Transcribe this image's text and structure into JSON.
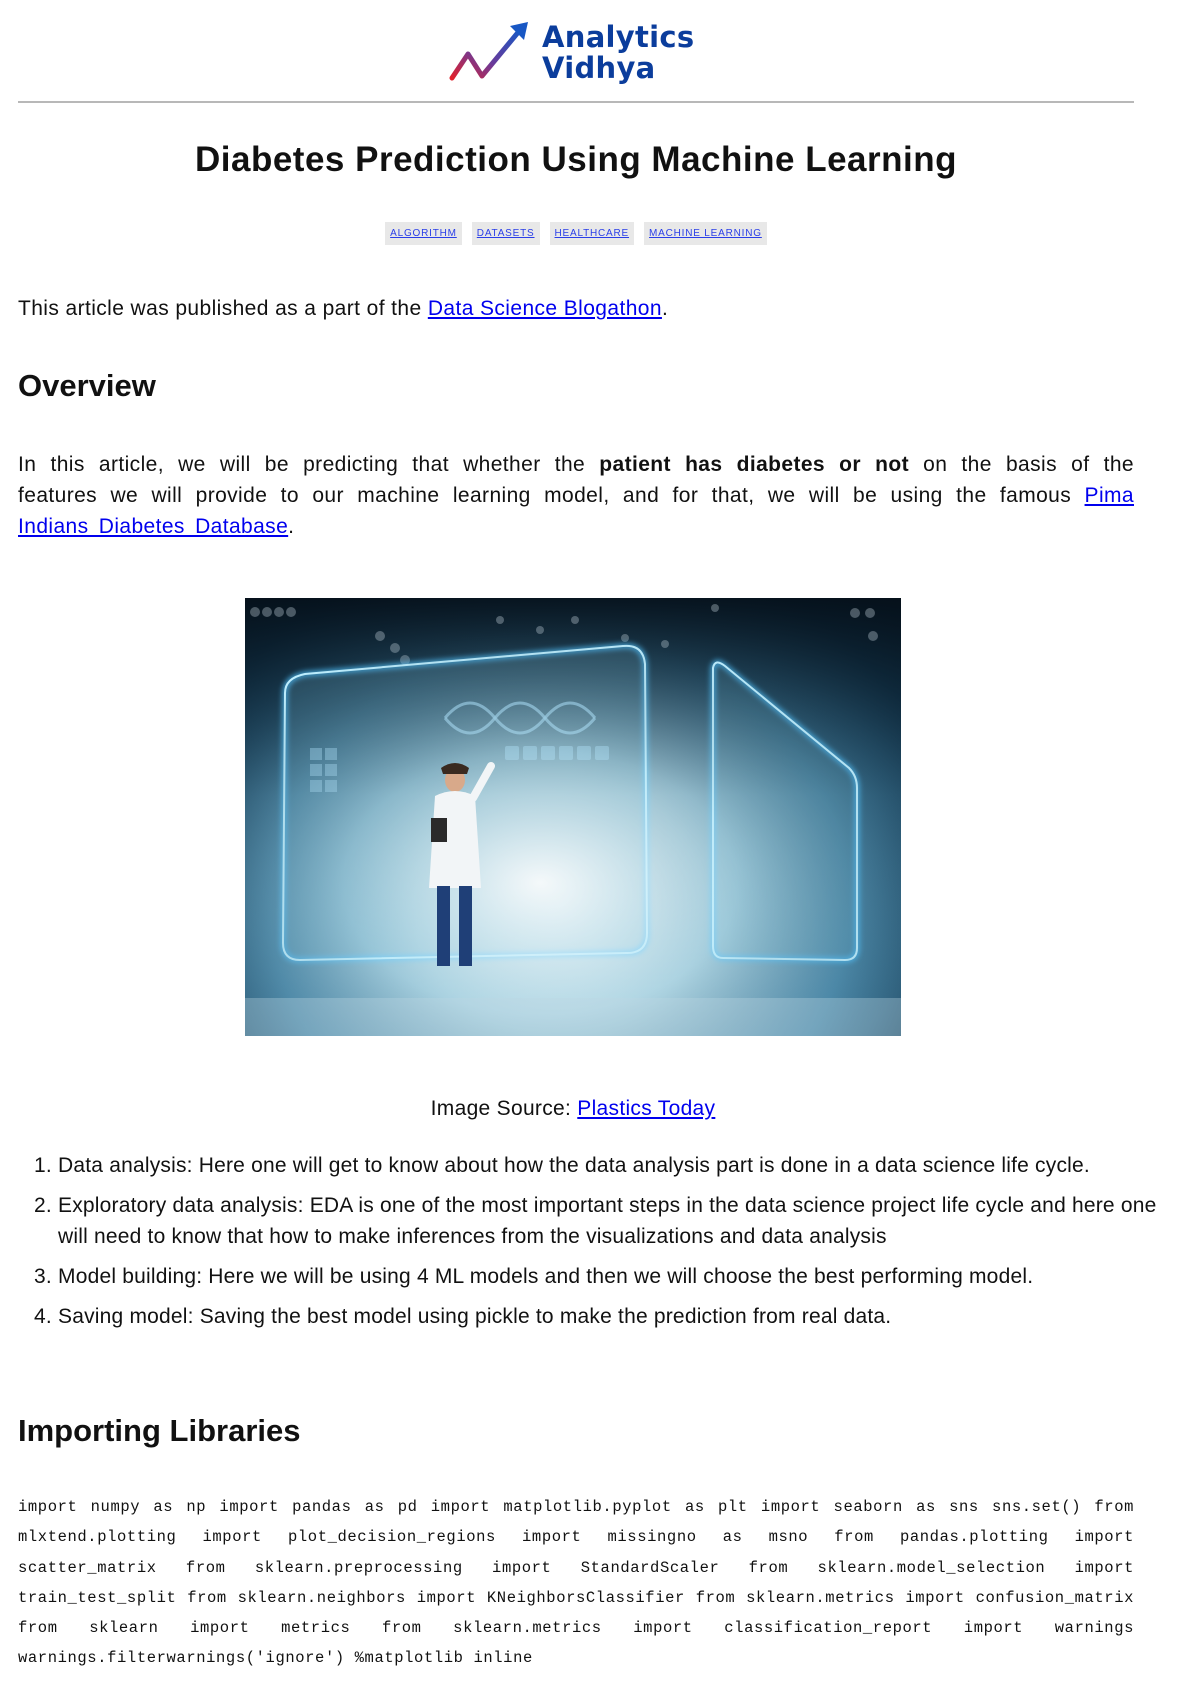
{
  "brand": {
    "name_line1": "Analytics",
    "name_line2": "Vidhya",
    "logo_icon": "trend-arrow-icon",
    "colors": {
      "brand_blue": "#0b3d9c",
      "accent_red": "#e0202c",
      "link": "#0000ee"
    }
  },
  "article": {
    "title": "Diabetes Prediction Using Machine Learning",
    "tags": [
      "ALGORITHM",
      "DATASETS",
      "HEALTHCARE",
      "MACHINE LEARNING"
    ],
    "intro": {
      "prefix": "This article was published as a part of the ",
      "link_text": "Data Science Blogathon",
      "suffix": "."
    },
    "overview": {
      "heading": "Overview",
      "text_before": "In this article, we will be predicting that whether the ",
      "bold_text": "patient has diabetes or not",
      "text_middle": " on the basis of the features we will provide to our machine learning model, and for that, we will be using the famous ",
      "link_text": "Pima Indians Diabetes Database",
      "suffix": "."
    },
    "hero_image": {
      "alt": "Doctor interacting with futuristic holographic medical screens"
    },
    "image_source": {
      "label": "Image Source: ",
      "link_text": "Plastics Today"
    },
    "steps": [
      "Data analysis: Here one will get to know about how the data analysis part is done in a data science life cycle.",
      "Exploratory data analysis: EDA is one of the most important steps in the data science project life cycle and here one will need to know that how to make inferences from the visualizations and data analysis",
      "Model building: Here we will be using 4 ML models and then we will choose the best performing model.",
      "Saving model: Saving the best model using pickle to make the prediction from real data."
    ],
    "importing": {
      "heading": "Importing Libraries",
      "code": "import numpy as np import pandas as pd import matplotlib.pyplot as plt import seaborn as sns sns.set() from mlxtend.plotting import plot_decision_regions import missingno as msno from pandas.plotting import scatter_matrix from sklearn.preprocessing import StandardScaler from sklearn.model_selection import train_test_split from sklearn.neighbors import KNeighborsClassifier from sklearn.metrics import confusion_matrix from sklearn import metrics from sklearn.metrics import classification_report import warnings warnings.filterwarnings('ignore') %matplotlib inline"
    }
  }
}
